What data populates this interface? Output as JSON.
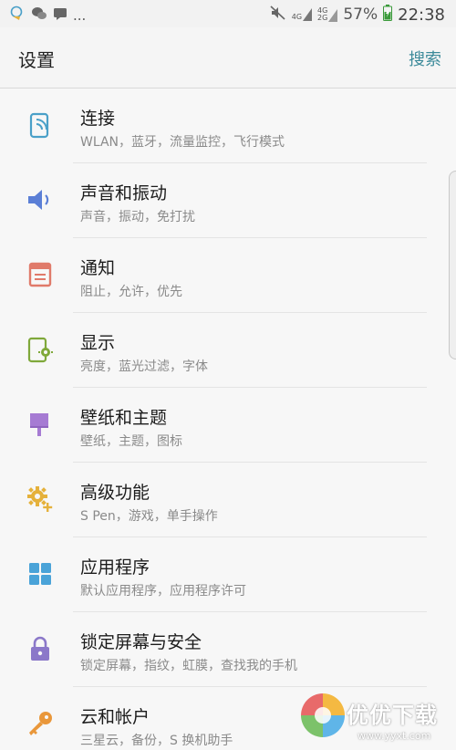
{
  "status_bar": {
    "left_icons": [
      "chat-bubble-icon",
      "wechat-icon",
      "message-icon"
    ],
    "more": "...",
    "network_1": "4G",
    "network_2a": "4G",
    "network_2b": "2G",
    "battery_percent": "57%",
    "time": "22:38"
  },
  "header": {
    "title": "设置",
    "search_label": "搜索"
  },
  "settings": [
    {
      "title": "连接",
      "subtitle": "WLAN，蓝牙，流量监控，飞行模式",
      "icon": "connections-icon",
      "color": "#4aa0c8"
    },
    {
      "title": "声音和振动",
      "subtitle": "声音，振动，免打扰",
      "icon": "speaker-icon",
      "color": "#5b7fd6"
    },
    {
      "title": "通知",
      "subtitle": "阻止，允许，优先",
      "icon": "notification-icon",
      "color": "#e07a6a"
    },
    {
      "title": "显示",
      "subtitle": "亮度，蓝光过滤，字体",
      "icon": "display-icon",
      "color": "#7fa83a"
    },
    {
      "title": "壁纸和主题",
      "subtitle": "壁纸，主题，图标",
      "icon": "wallpaper-icon",
      "color": "#a67bd3"
    },
    {
      "title": "高级功能",
      "subtitle": "S Pen，游戏，单手操作",
      "icon": "advanced-gear-icon",
      "color": "#e5b13b"
    },
    {
      "title": "应用程序",
      "subtitle": "默认应用程序，应用程序许可",
      "icon": "apps-grid-icon",
      "color": "#4aa3d8"
    },
    {
      "title": "锁定屏幕与安全",
      "subtitle": "锁定屏幕，指纹，虹膜，查找我的手机",
      "icon": "lock-icon",
      "color": "#8b78c9"
    },
    {
      "title": "云和帐户",
      "subtitle": "三星云，备份，S 换机助手",
      "icon": "key-icon",
      "color": "#e9973a"
    }
  ],
  "watermark": {
    "text": "优优下载",
    "url": "www.yyxt.com"
  }
}
